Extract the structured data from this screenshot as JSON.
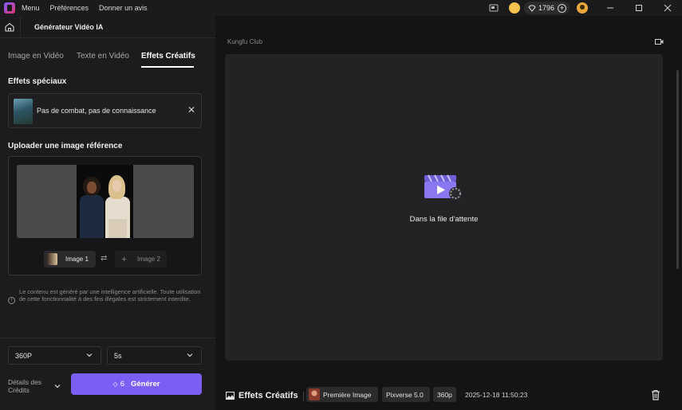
{
  "menu": {
    "items": [
      "Menu",
      "Préférences",
      "Donner un avis"
    ]
  },
  "topbar": {
    "credits": "1796",
    "icons": [
      "screen-record-icon",
      "coin-icon",
      "diamond-icon",
      "plus-icon",
      "user-icon",
      "minimize-icon",
      "maximize-icon",
      "close-icon"
    ]
  },
  "header": {
    "title": "Générateur Vidéo IA"
  },
  "tabs": [
    {
      "label": "Image en Vidéo",
      "active": false
    },
    {
      "label": "Texte en Vidéo",
      "active": false
    },
    {
      "label": "Effets Créatifs",
      "active": true
    }
  ],
  "effects": {
    "section_title": "Effets spéciaux",
    "selected_effect": "Pas de combat, pas de connaissance"
  },
  "upload": {
    "section_title": "Uploader une image référence",
    "image1_label": "Image 1",
    "image2_label": "Image 2"
  },
  "disclaimer": "Le contenu est généré par une intelligence artificielle. Toute utilisation de cette fonctionnalité à des fins illégales est strictement interdite.",
  "settings": {
    "resolution": "360P",
    "duration": "5s"
  },
  "footer": {
    "credits_details_label": "Détails des Crédits",
    "generate_cost": "6",
    "generate_label": "Générer"
  },
  "preview": {
    "project_name": "Kungfu Club",
    "status": "Dans la file d'attente"
  },
  "task": {
    "title": "Effets Créatifs",
    "source": "Première Image",
    "model": "Pixverse 5.0",
    "resolution": "360p",
    "timestamp": "2025-12-18 11:50:23"
  },
  "colors": {
    "accent": "#7b5ff5",
    "background": "#141414",
    "panel": "#1c1c1e"
  }
}
